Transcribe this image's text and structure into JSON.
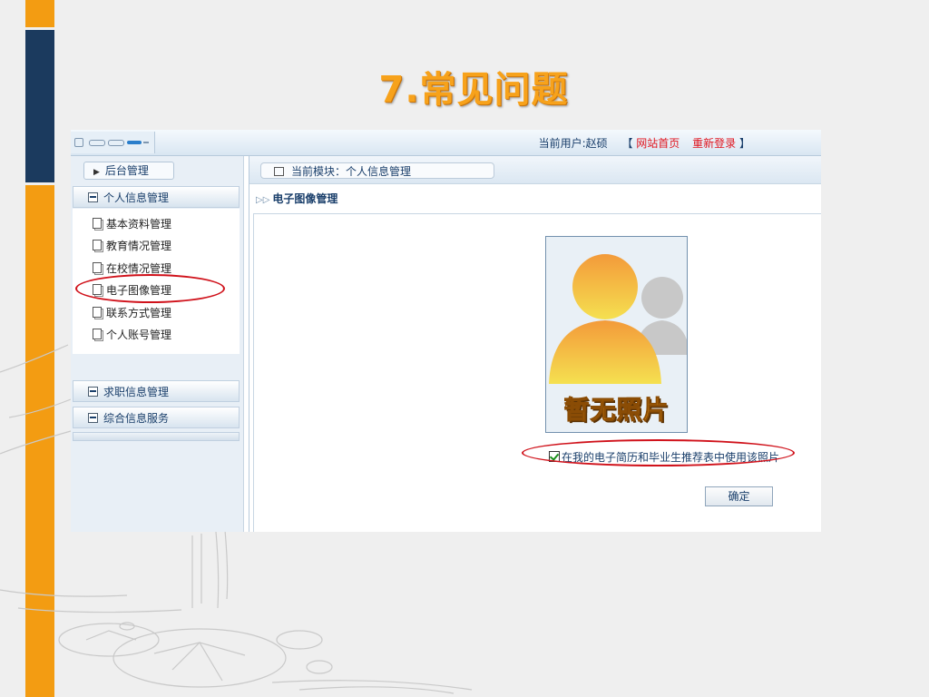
{
  "slide": {
    "title": "7.常见问题"
  },
  "topbar": {
    "current_user": "当前用户:赵硕",
    "bracket_open": "【",
    "home_link": "网站首页",
    "relogin_link": "重新登录",
    "bracket_close": "】"
  },
  "sidebar": {
    "header": "后台管理",
    "sections": [
      {
        "label": "个人信息管理"
      },
      {
        "label": "求职信息管理"
      },
      {
        "label": "综合信息服务"
      }
    ],
    "items": [
      {
        "label": "基本资料管理"
      },
      {
        "label": "教育情况管理"
      },
      {
        "label": "在校情况管理"
      },
      {
        "label": "电子图像管理"
      },
      {
        "label": "联系方式管理"
      },
      {
        "label": "个人账号管理"
      }
    ]
  },
  "main": {
    "breadcrumb": "当前模块：个人信息管理",
    "section_title": "电子图像管理",
    "no_photo_text": "暂无照片",
    "checkbox_label": "在我的电子简历和毕业生推荐表中使用该照片",
    "checkbox_checked": true,
    "confirm_button": "确定"
  },
  "colors": {
    "accent_orange": "#f39c12",
    "navy": "#1b3a5e",
    "highlight_red": "#d0121b",
    "link_red": "#e0141e"
  }
}
